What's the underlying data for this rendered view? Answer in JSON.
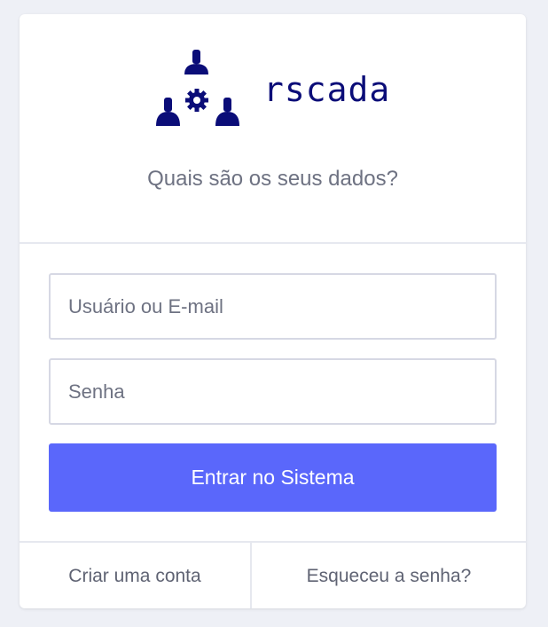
{
  "brand": {
    "name": "rscada",
    "logo_icon": "people-gear-icon",
    "color": "#0b0d78"
  },
  "header": {
    "subtitle": "Quais são os seus dados?"
  },
  "form": {
    "username_placeholder": "Usuário ou E-mail",
    "username_value": "",
    "password_placeholder": "Senha",
    "password_value": "",
    "submit_label": "Entrar no Sistema",
    "submit_color": "#5a67fb"
  },
  "footer": {
    "create_account_label": "Criar uma conta",
    "forgot_password_label": "Esqueceu a senha?"
  }
}
